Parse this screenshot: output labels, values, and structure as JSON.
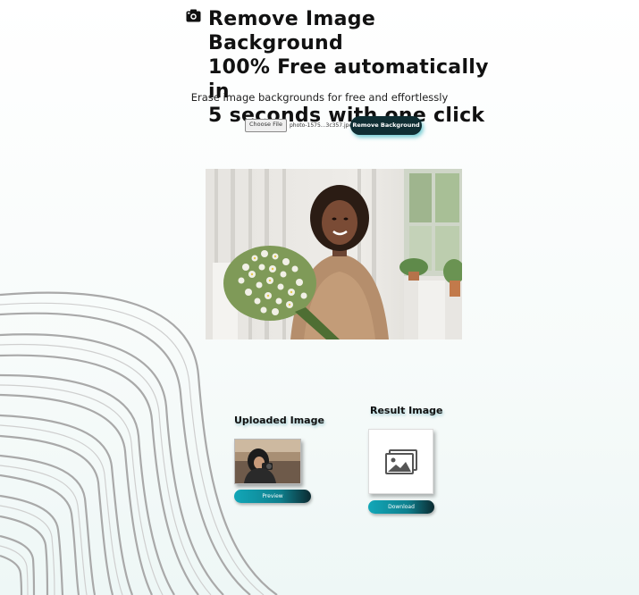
{
  "header": {
    "icon": "camera-icon",
    "title_line1": "Remove Image Background",
    "title_line2": "100% Free automatically in",
    "title_line3": "5 seconds with one click",
    "subtitle": "Erase image backgrounds for free and effortlessly"
  },
  "upload": {
    "choose_file_label": "Choose File",
    "file_name": "photo-1575...3c357.jpeg",
    "remove_button_label": "Remove Background"
  },
  "uploaded": {
    "title": "Uploaded Image",
    "preview_label": "Preview"
  },
  "result": {
    "title": "Result Image",
    "placeholder_icon": "image-placeholder-icon",
    "download_label": "Download"
  },
  "colors": {
    "accent": "#12a7b8",
    "dark_button": "#0f2e33"
  }
}
